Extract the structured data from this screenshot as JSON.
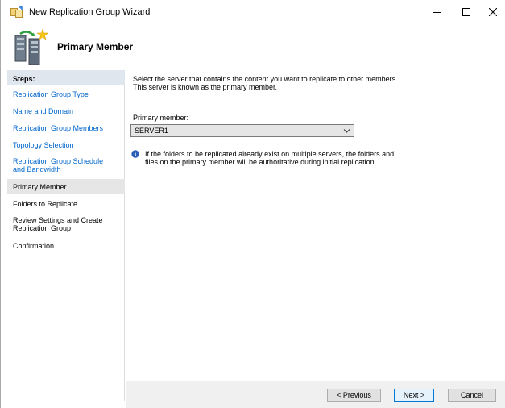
{
  "window": {
    "title": "New Replication Group Wizard"
  },
  "header": {
    "title": "Primary Member"
  },
  "steps": {
    "heading": "Steps:",
    "items": [
      {
        "label": "Replication Group Type",
        "state": "link"
      },
      {
        "label": "Name and Domain",
        "state": "link"
      },
      {
        "label": "Replication Group Members",
        "state": "link"
      },
      {
        "label": "Topology Selection",
        "state": "link"
      },
      {
        "label": "Replication Group Schedule\nand Bandwidth",
        "state": "link"
      },
      {
        "label": "Primary Member",
        "state": "current"
      },
      {
        "label": "Folders to Replicate",
        "state": "plain"
      },
      {
        "label": "Review Settings and Create\nReplication Group",
        "state": "plain"
      },
      {
        "label": "Confirmation",
        "state": "plain"
      }
    ]
  },
  "content": {
    "intro": "Select the server that contains the content you want to replicate to other members.\nThis server is known as the primary member.",
    "primary_member_label": "Primary member:",
    "primary_member_value": "SERVER1",
    "info_text": "If the folders to be replicated already exist on multiple servers, the folders and\nfiles on the primary member will be authoritative during initial replication."
  },
  "footer": {
    "previous_label": "< Previous",
    "next_label": "Next >",
    "cancel_label": "Cancel"
  },
  "colors": {
    "link": "#0066cc",
    "steps_heading_bg": "#dfe6ee",
    "current_step_bg": "#e6e6e6",
    "footer_bg": "#f0f0f0",
    "default_button_border": "#0078d7"
  }
}
